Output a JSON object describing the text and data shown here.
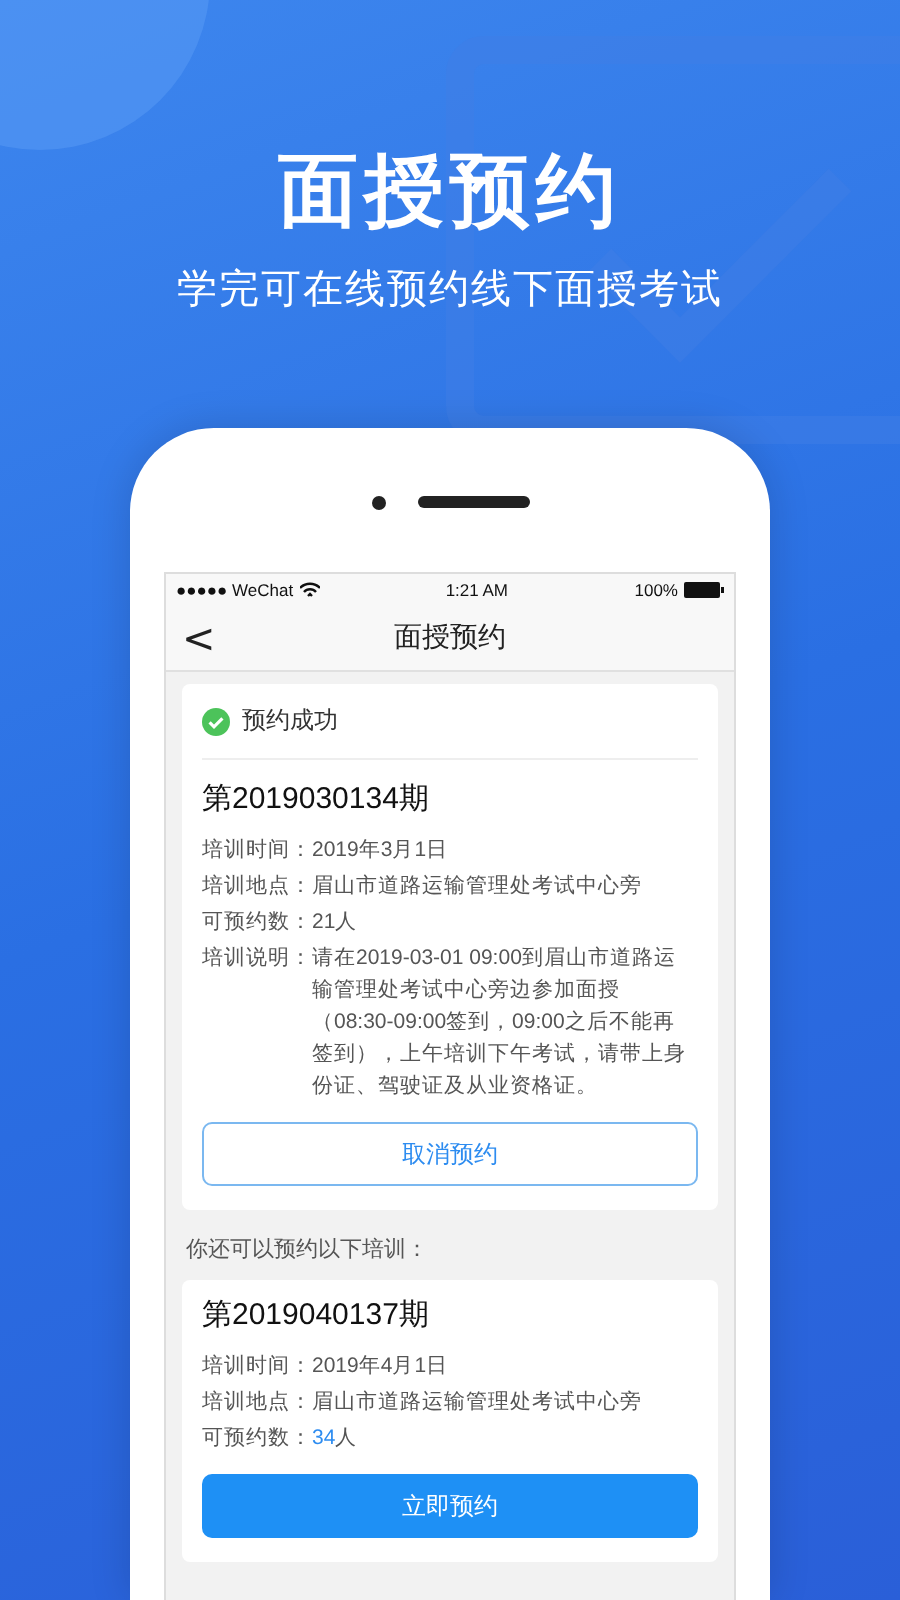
{
  "headline": "面授预约",
  "subheadline": "学完可在线预约线下面授考试",
  "status_bar": {
    "carrier": "●●●●● WeChat",
    "time": "1:21 AM",
    "battery": "100%"
  },
  "nav": {
    "back": "<",
    "title": "面授预约"
  },
  "booked": {
    "status": "预约成功",
    "period": "第2019030134期",
    "rows": [
      {
        "label": "培训时间：",
        "value": "2019年3月1日"
      },
      {
        "label": "培训地点：",
        "value": "眉山市道路运输管理处考试中心旁"
      }
    ],
    "available": {
      "label": "可预约数：",
      "count": "21",
      "unit": "人",
      "highlight": false
    },
    "note": {
      "label": "培训说明：",
      "value": "请在2019-03-01 09:00到眉山市道路运输管理处考试中心旁边参加面授（08:30-09:00签到，09:00之后不能再签到），上午培训下午考试，请带上身份证、驾驶证及从业资格证。"
    },
    "button": {
      "label": "取消预约",
      "kind": "outline"
    }
  },
  "more_label": "你还可以预约以下培训：",
  "upcoming": [
    {
      "period": "第2019040137期",
      "rows": [
        {
          "label": "培训时间：",
          "value": "2019年4月1日"
        },
        {
          "label": "培训地点：",
          "value": "眉山市道路运输管理处考试中心旁"
        }
      ],
      "available": {
        "label": "可预约数：",
        "count": "34",
        "unit": "人",
        "highlight": true
      },
      "button": {
        "label": "立即预约",
        "kind": "filled"
      }
    }
  ]
}
